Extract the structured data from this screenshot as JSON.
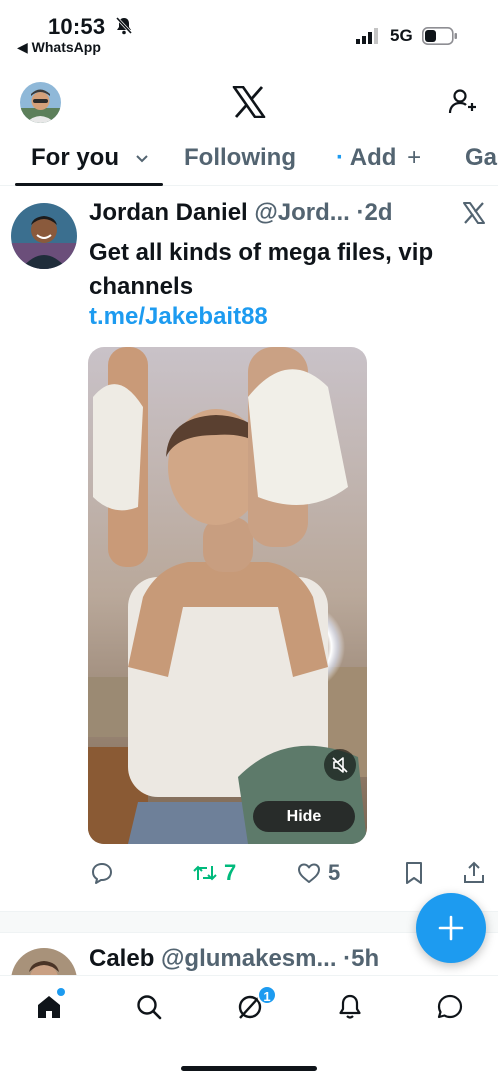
{
  "status_bar": {
    "time": "10:53",
    "back_app": "◀ WhatsApp",
    "network": "5G"
  },
  "tabs": [
    {
      "label": "For you",
      "icon": "chevron-down-icon"
    },
    {
      "label": "Following"
    },
    {
      "label": "Add",
      "prefix": "·",
      "suffix": "+"
    },
    {
      "label": "Ga"
    }
  ],
  "post": {
    "author_name": "Jordan Daniel",
    "handle": "@Jord...",
    "age": "2d",
    "text": "Get all kinds of mega files, vip channels",
    "link": "t.me/Jakebait88",
    "hide_label": "Hide",
    "retweets": "7",
    "likes": "5"
  },
  "next_post": {
    "author_name": "Caleb",
    "handle": "@glumakesm...",
    "age": "5h"
  },
  "bottom_nav": {
    "notifications_badge": "1"
  },
  "colors": {
    "accent": "#1d9bf0",
    "retweet": "#00ba7c",
    "text": "#0f1419",
    "muted": "#536471"
  }
}
